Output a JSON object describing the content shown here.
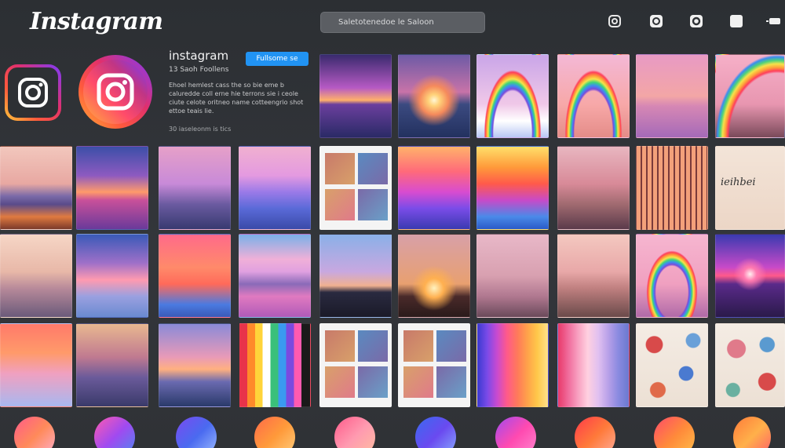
{
  "header": {
    "logo": "Instagram",
    "search_text": "Saletotenedoe  le  Saloon",
    "icons": [
      "camera-icon",
      "reels-icon",
      "camera-icon",
      "square-icon",
      "battery-icon"
    ]
  },
  "profile": {
    "username": "instagram",
    "follow_label": "Fullsome   se",
    "stats": "13 Saoh    Foollens",
    "bio": "Ehoel hemlest cass the so bie eme b caluredde coll erne hie terrons sie i ceole ciute celote oritneo name cotteengrio shot ettoe teais lie.",
    "meta": "30 iaseleonm is  tics"
  },
  "tiles": [
    {
      "name": "sunset-ocean-tile",
      "bg": "linear-gradient(180deg,#3a2a6e 0%,#b65ac4 40%,#ffb06a 55%,#6b3f9e 60%,#2a2a66 100%)"
    },
    {
      "name": "sunset-sea-tile",
      "bg": "radial-gradient(circle at 50% 55%,#fff7d6 0,#ffd27a 10%,#f58a5c 25%,rgba(0,0,0,0) 45%),linear-gradient(180deg,#6d5aa6 0%,#c873a8 45%,#3b4a80 60%,#23315f 100%)"
    },
    {
      "name": "rainbow-clouds-tile",
      "bg": "radial-gradient(ellipse at 50% 95%,rgba(0,0,0,0) 38%,#7b4bd8 40%,#3e8cf0 43%,#3ed57a 46%,#f6e44a 49%,#ff9a3a 52%,#ff3e5a 55%,rgba(0,0,0,0) 57%),linear-gradient(180deg,#c9a5e8 0%,#f0c8e8 60%,#ffffff 80%,#b9c8f5 100%)"
    },
    {
      "name": "rainbow-people-tile",
      "bg": "radial-gradient(ellipse at 50% 95%,rgba(0,0,0,0) 38%,#7b4bd8 40%,#3e8cf0 43%,#3ed57a 46%,#f6e44a 49%,#ff9a3a 52%,#ff3e5a 55%,rgba(0,0,0,0) 57%),linear-gradient(180deg,#f3b8d6 0%,#f7a8a8 60%,#e48c88 100%)"
    },
    {
      "name": "palm-sea-tile",
      "bg": "linear-gradient(180deg,#e89ac4 0%,#f3a6a6 50%,#d687b4 62%,#a56ab8 100%)"
    },
    {
      "name": "rainbow-field-tile",
      "bg": "radial-gradient(ellipse at 90% 100%,rgba(0,0,0,0) 55%,#ff3e5a 57%,#ffa23a 60%,#f5e24a 63%,#4ed27a 66%,#3b8cf0 69%,rgba(0,0,0,0) 71%),linear-gradient(180deg,#f6b0c8 0%,#e896b0 60%,#7a4a5a 100%)"
    },
    {
      "name": "mountain-flowers-tile",
      "bg": "linear-gradient(180deg,#f2c7bd 0%,#e8a8a2 45%,#7a6aa8 60%,#5a4b8a 70%,#e07a40 85%,#7b3a2a 100%)"
    },
    {
      "name": "sunset-hills-tile",
      "bg": "linear-gradient(180deg,#3c4fa8 0%,#8d5ac0 35%,#ff9a6a 55%,#c8509a 65%,#6a3a9a 100%)"
    },
    {
      "name": "lone-tree-tile",
      "bg": "linear-gradient(180deg,#e6a0c8 0%,#c88ad8 45%,#6a5aa0 70%,#383a70 100%)"
    },
    {
      "name": "pink-waves-tile",
      "bg": "linear-gradient(180deg,#f0b0d0 0%,#e49ae0 35%,#9a7ae8 55%,#5a6ad8 75%,#3a4aa8 100%)"
    },
    {
      "name": "photo-collage-tile",
      "bg": "linear-gradient(180deg,#f4f4f4 0%,#f4f4f4 100%)",
      "collage": true
    },
    {
      "name": "gradient-hills-tile",
      "bg": "linear-gradient(180deg,#ffb26a 0%,#ff6a7a 30%,#d84cd0 55%,#7a4ce8 75%,#3a3ab0 100%)"
    },
    {
      "name": "layered-waves-tile",
      "bg": "linear-gradient(180deg,#ffdf6a 0%,#ff9a3a 25%,#ff5a4a 45%,#c84ac8 65%,#4a8ae8 85%,#2a5ac8 100%)"
    },
    {
      "name": "people-sunset-tile",
      "bg": "linear-gradient(180deg,#e8b6c0 0%,#d88a98 45%,#a06a70 70%,#5a3a4a 100%)"
    },
    {
      "name": "silhouette-bars-tile",
      "bg": "repeating-linear-gradient(90deg,#f3a07a 0,#f3a07a 5px,#7a3a3a 5px,#7a3a3a 7px),linear-gradient(180deg,#ffc090 0%,#c05050 100%)"
    },
    {
      "name": "text-plants-tile",
      "bg": "linear-gradient(180deg,#f3e4d8 0%,#ecd6c6 100%)",
      "caption": "ieihbei"
    },
    {
      "name": "misty-sea-tile",
      "bg": "linear-gradient(180deg,#f6d6c6 0%,#e8b8a8 45%,#b88a9a 65%,#6a5a7a 100%)"
    },
    {
      "name": "gradient-sky-tile",
      "bg": "linear-gradient(180deg,#3a5ab8 0%,#a070c8 35%,#ff9ab0 55%,#9aa0e0 75%,#6a8ad0 100%)"
    },
    {
      "name": "gradient-stripe-tile",
      "bg": "linear-gradient(180deg,#ff6a8a 0%,#ff8a6a 40%,#ff6a5a 60%,#4a7ae0 85%,#3a5ab8 100%)"
    },
    {
      "name": "lavender-field-tile",
      "bg": "linear-gradient(180deg,#7ab0e8 0%,#f0b0d8 30%,#e0a0e0 45%,#8a6ab8 60%,#e07ac0 75%,#b05ab8 100%)"
    },
    {
      "name": "meditation-tile",
      "bg": "linear-gradient(180deg,#8ab0e8 0%,#c8a8e0 45%,#f0b090 62%,#2a2a40 70%,#1a1a28 100%)"
    },
    {
      "name": "tree-sunset-tile",
      "bg": "radial-gradient(circle at 50% 65%,#fff2c0 0,#ffb050 15%,rgba(0,0,0,0) 35%),linear-gradient(180deg,#d8a0a8 0%,#e8a070 60%,#4a2a2a 75%,#2a1a1a 100%)"
    },
    {
      "name": "couple-sunset-tile",
      "bg": "linear-gradient(180deg,#e8b8c8 0%,#d8a0b0 50%,#b07890 75%,#6a4a5a 100%)"
    },
    {
      "name": "floral-sea-tile",
      "bg": "linear-gradient(180deg,#f4c8c0 0%,#e8a8a8 45%,#c08080 65%,#6a4a4a 100%)"
    },
    {
      "name": "rainbow-sea-tile",
      "bg": "radial-gradient(ellipse at 50% 70%,rgba(0,0,0,0) 32%,#7b4bd8 34%,#3e8cf0 37%,#3ed57a 40%,#f6e44a 43%,#ff9a3a 46%,#ff3e5a 49%,rgba(0,0,0,0) 51%),linear-gradient(180deg,#f6b6d0 0%,#f0a0c0 60%,#b06aa8 100%)"
    },
    {
      "name": "grid-sunset-tile",
      "bg": "radial-gradient(circle at 50% 48%,#fff0f0 0,#ff7ab0 12%,rgba(0,0,0,0) 30%),linear-gradient(180deg,#3a3ab0 0%,#c84ac8 40%,#ff5a8a 50%,#5a2a8a 60%,#2a1a4a 100%)"
    },
    {
      "name": "orange-gradient-tile",
      "bg": "linear-gradient(180deg,#ff7a6a 0%,#ff9a6a 35%,#f0a0c0 60%,#a8b8f0 100%)"
    },
    {
      "name": "painted-mountain-tile",
      "bg": "linear-gradient(180deg,#e8b890 0%,#c07a90 40%,#6a5a9a 65%,#3a3a6a 100%)"
    },
    {
      "name": "ocean-dusk-tile",
      "bg": "linear-gradient(180deg,#8a8ad8 0%,#e89ab8 40%,#ffb080 55%,#6a6ab0 70%,#2a3a6a 100%)"
    },
    {
      "name": "vertical-stripes-tile",
      "bg": "linear-gradient(90deg,#e8334a 0,#e8334a 11%,#ff8a2a 11%,#ff8a2a 22%,#ffd43a 22%,#ffd43a 33%,#ffffff 33%,#ffffff 44%,#3ac07a 44%,#3ac07a 55%,#3a9af0 55%,#3a9af0 66%,#7a4ae0 66%,#7a4ae0 77%,#ff5ab0 77%,#ff5ab0 88%,#1a1a1a 88%,#1a1a1a 100%)"
    },
    {
      "name": "photo-collage-2-tile",
      "bg": "linear-gradient(180deg,#f4f4f4 0%,#f4f4f4 100%)",
      "collage": true
    },
    {
      "name": "photo-collage-3-tile",
      "bg": "linear-gradient(180deg,#f4f4f4 0%,#f4f4f4 100%)",
      "collage": true
    },
    {
      "name": "spectrum-stripes-tile",
      "bg": "linear-gradient(90deg,#3a3ad0 0%,#7a4ae8 14%,#c84ad0 28%,#ff5a8a 42%,#ff7a5a 57%,#ffa24a 71%,#ffc84a 85%,#ffe08a 100%)"
    },
    {
      "name": "pastel-stripes-tile",
      "bg": "linear-gradient(90deg,#e83a6a 0%,#f06a9a 14%,#f8a0c0 28%,#ffd0e0 42%,#e0c0f0 57%,#b8a0e8 71%,#8a8ae0 85%,#6a7ad0 100%)"
    },
    {
      "name": "floral-pattern-tile",
      "bg": "radial-gradient(circle at 25% 25%,#d84a4a 0,#d84a4a 10%,rgba(0,0,0,0) 11%),radial-gradient(circle at 70% 60%,#4a7ad0 0,#4a7ad0 10%,rgba(0,0,0,0) 11%),radial-gradient(circle at 30% 80%,#e06a4a 0,#e06a4a 9%,rgba(0,0,0,0) 10%),radial-gradient(circle at 80% 20%,#6aa0d8 0,#6aa0d8 8%,rgba(0,0,0,0) 9%),linear-gradient(180deg,#f4ece4 0%,#ece0d4 100%)"
    },
    {
      "name": "floral-pattern-2-tile",
      "bg": "radial-gradient(circle at 30% 30%,#e07a8a 0,#e07a8a 12%,rgba(0,0,0,0) 13%),radial-gradient(circle at 75% 70%,#d84a4a 0,#d84a4a 11%,rgba(0,0,0,0) 12%),radial-gradient(circle at 75% 25%,#5a9ad0 0,#5a9ad0 9%,rgba(0,0,0,0) 10%),radial-gradient(circle at 25% 80%,#6ab0a0 0,#6ab0a0 8%,rgba(0,0,0,0) 9%),linear-gradient(180deg,#f4ece4 0%,#ece0d4 100%)"
    }
  ],
  "bottom_circles": [
    "linear-gradient(135deg,#ff5a8a,#ff8a5a,#ffb0d0)",
    "linear-gradient(135deg,#ff5ab0,#a04af0,#4a8af0)",
    "linear-gradient(135deg,#7a4af0,#4a6af0,#a0c0ff)",
    "linear-gradient(135deg,#ff6a4a,#ff9a3a,#ffd080)",
    "linear-gradient(135deg,#ff5a8a,#ff9ab0,#ffc0a0)",
    "linear-gradient(135deg,#3a6af0,#6a4af0,#8ab0ff)",
    "linear-gradient(135deg,#a04af0,#ff4ab0,#ff8ad0)",
    "linear-gradient(135deg,#ff3a4a,#ff7a3a,#ffb0a0)",
    "linear-gradient(135deg,#ff4a6a,#ff8a3a,#ffc04a)",
    "linear-gradient(135deg,#ff7a3a,#ffb04a,#ff5a6a)"
  ]
}
